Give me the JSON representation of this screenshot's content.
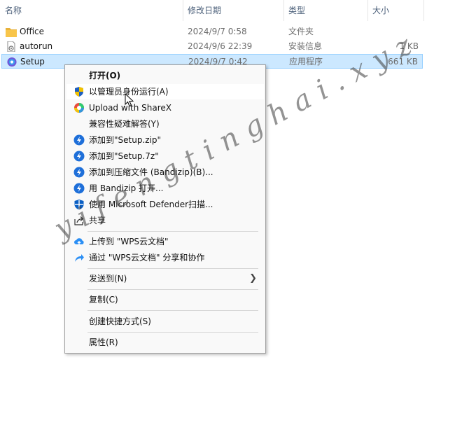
{
  "columns": {
    "name": "名称",
    "date": "修改日期",
    "type": "类型",
    "size": "大小"
  },
  "files": [
    {
      "name": "Office",
      "date": "2024/9/7 0:58",
      "type": "文件夹",
      "size": "",
      "icon": "folder-icon"
    },
    {
      "name": "autorun",
      "date": "2024/9/6 22:39",
      "type": "安装信息",
      "size": "1 KB",
      "icon": "inf-file-icon"
    },
    {
      "name": "Setup",
      "date": "2024/9/7 0:42",
      "type": "应用程序",
      "size": "661 KB",
      "icon": "office-setup-icon"
    }
  ],
  "menu": {
    "items": [
      {
        "label": "打开(O)",
        "icon": ""
      },
      {
        "label": "以管理员身份运行(A)",
        "icon": "uac-shield-icon"
      },
      {
        "label": "Upload with ShareX",
        "icon": "sharex-icon"
      },
      {
        "label": "兼容性疑难解答(Y)",
        "icon": ""
      },
      {
        "label": "添加到\"Setup.zip\"",
        "icon": "bandizip-icon"
      },
      {
        "label": "添加到\"Setup.7z\"",
        "icon": "bandizip-icon"
      },
      {
        "label": "添加到压缩文件 (Bandizip)(B)...",
        "icon": "bandizip-icon"
      },
      {
        "label": "用 Bandizip 打开...",
        "icon": "bandizip-icon"
      },
      {
        "label": "使用 Microsoft Defender扫描...",
        "icon": "defender-icon"
      },
      {
        "label": "共享",
        "icon": "share-icon"
      },
      {
        "label": "上传到 \"WPS云文档\"",
        "icon": "wps-upload-icon"
      },
      {
        "label": "通过 \"WPS云文档\" 分享和协作",
        "icon": "wps-share-icon"
      },
      {
        "label": "发送到(N)",
        "icon": ""
      },
      {
        "label": "复制(C)",
        "icon": ""
      },
      {
        "label": "创建快捷方式(S)",
        "icon": ""
      },
      {
        "label": "属性(R)",
        "icon": ""
      }
    ]
  },
  "watermark": "yifengtinghai.xyz",
  "colors": {
    "selection": "#cce8ff",
    "accent": "#0067c0",
    "folder": "#f8c54a"
  }
}
